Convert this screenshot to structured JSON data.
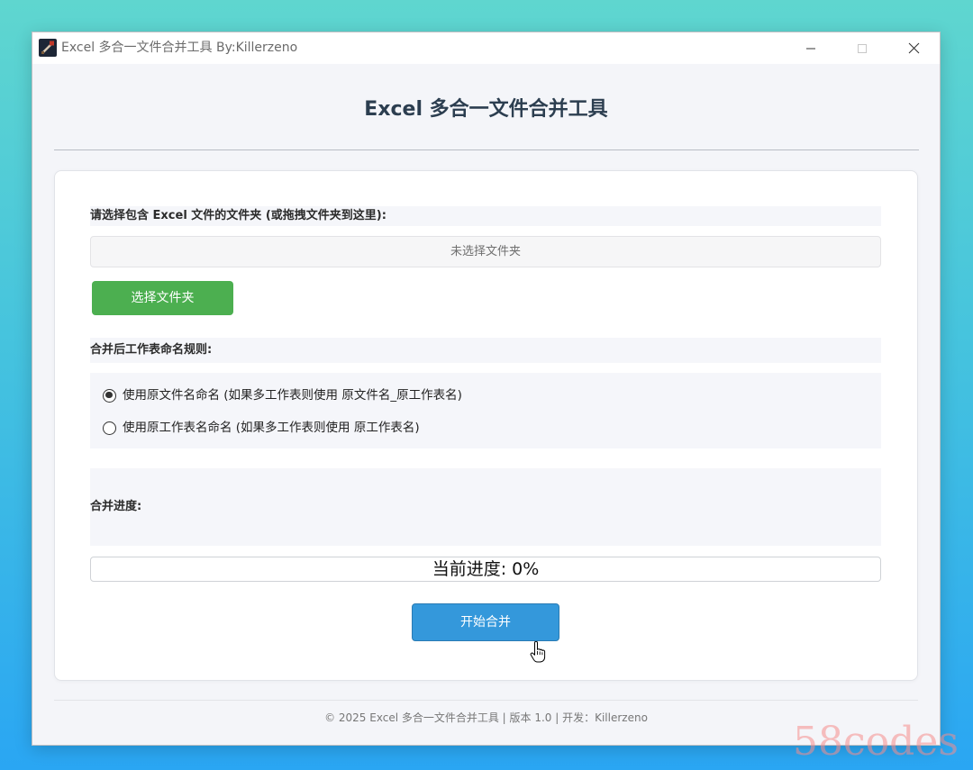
{
  "window": {
    "title": "Excel 多合一文件合并工具 By:Killerzeno",
    "app_icon": "app-icon",
    "controls": [
      "minimize-icon",
      "maximize-icon",
      "close-icon"
    ]
  },
  "header": {
    "title": "Excel 多合一文件合并工具"
  },
  "folder": {
    "label": "请选择包含 Excel 文件的文件夹 (或拖拽文件夹到这里):",
    "path_display": "未选择文件夹",
    "select_button": "选择文件夹"
  },
  "naming": {
    "label": "合并后工作表命名规则:",
    "options": [
      {
        "label": "使用原文件名命名 (如果多工作表则使用 原文件名_原工作表名)",
        "selected": true
      },
      {
        "label": "使用原工作表名命名 (如果多工作表则使用 原工作表名)",
        "selected": false
      }
    ]
  },
  "progress": {
    "label": "合并进度:",
    "text": "当前进度: 0%",
    "value": 0
  },
  "actions": {
    "start_button": "开始合并"
  },
  "footer": {
    "text": "© 2025 Excel 多合一文件合并工具 | 版本 1.0 | 开发：Killerzeno"
  },
  "watermark": "58codes",
  "colors": {
    "select_button": "#4caf50",
    "start_button": "#3498db",
    "heading": "#2c3e50",
    "page_background": "#f4f5f9"
  }
}
